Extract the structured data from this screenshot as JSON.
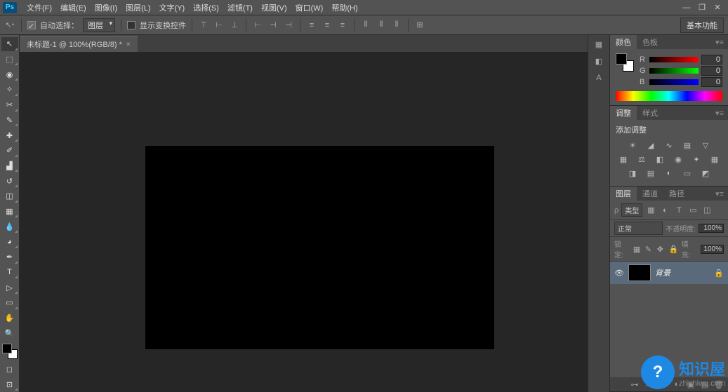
{
  "app": {
    "logo": "Ps"
  },
  "menu": [
    "文件(F)",
    "编辑(E)",
    "图像(I)",
    "图层(L)",
    "文字(Y)",
    "选择(S)",
    "滤镜(T)",
    "视图(V)",
    "窗口(W)",
    "帮助(H)"
  ],
  "optbar": {
    "auto_select_label": "自动选择：",
    "auto_select_dd": "图层",
    "show_transform": "显示变换控件",
    "workspace_pill": "基本功能"
  },
  "document": {
    "tab_title": "未标题-1 @ 100%(RGB/8) *"
  },
  "color_panel": {
    "tabs": [
      "颜色",
      "色板"
    ],
    "channels": [
      {
        "label": "R",
        "value": "0"
      },
      {
        "label": "G",
        "value": "0"
      },
      {
        "label": "B",
        "value": "0"
      }
    ]
  },
  "adjust_panel": {
    "tabs": [
      "调整",
      "样式"
    ],
    "title": "添加调整"
  },
  "layers_panel": {
    "tabs": [
      "图层",
      "通道",
      "路径"
    ],
    "kind_label": "类型",
    "blend_mode": "正常",
    "opacity_label": "不透明度:",
    "opacity_value": "100%",
    "lock_label": "锁定:",
    "fill_label": "填充:",
    "fill_value": "100%",
    "layer_name": "背景"
  },
  "watermark": {
    "brand": "知识屋",
    "url": "zhishiwu.com"
  }
}
